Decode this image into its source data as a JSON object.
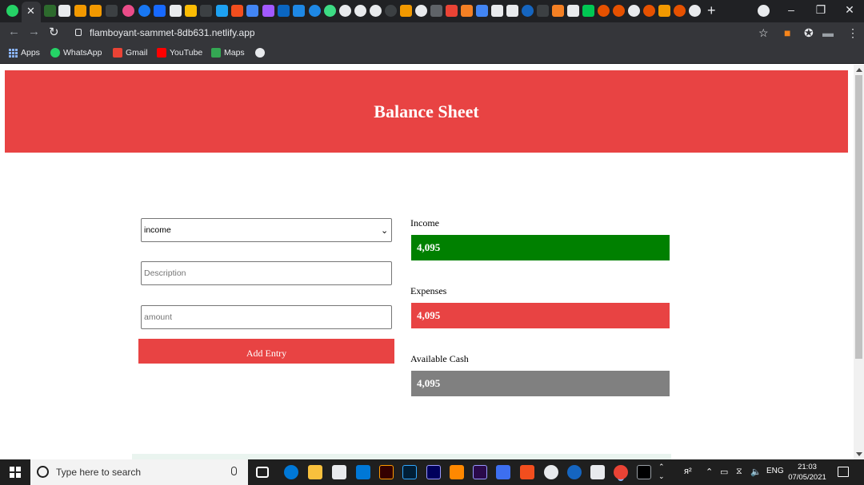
{
  "browser": {
    "tab_close_symbol": "✕",
    "new_tab_symbol": "+",
    "url": "flamboyant-sammet-8db631.netlify.app",
    "bookmarks": [
      {
        "label": "Apps",
        "icon": "apps-grid-icon",
        "color": "#8ab4f8"
      },
      {
        "label": "WhatsApp",
        "icon": "whatsapp-icon",
        "color": "#25d366"
      },
      {
        "label": "Gmail",
        "icon": "gmail-icon",
        "color": "#ea4335"
      },
      {
        "label": "YouTube",
        "icon": "youtube-icon",
        "color": "#ff0000"
      },
      {
        "label": "Maps",
        "icon": "maps-icon",
        "color": "#34a853"
      }
    ]
  },
  "page": {
    "title": "Balance Sheet",
    "form": {
      "type_select": {
        "selected": "income",
        "options": [
          "income"
        ]
      },
      "description_placeholder": "Description",
      "amount_placeholder": "amount",
      "add_button_label": "Add Entry"
    },
    "summary": {
      "income": {
        "label": "Income",
        "value": "4,095",
        "color": "#008000"
      },
      "expenses": {
        "label": "Expenses",
        "value": "4,095",
        "color": "#e84343"
      },
      "available_cash": {
        "label": "Available Cash",
        "value": "4,095",
        "color": "#808080"
      }
    },
    "accent_color": "#e84343"
  },
  "taskbar": {
    "search_placeholder": "Type here to search",
    "language": "ENG",
    "time": "21:03",
    "date": "07/05/2021"
  }
}
